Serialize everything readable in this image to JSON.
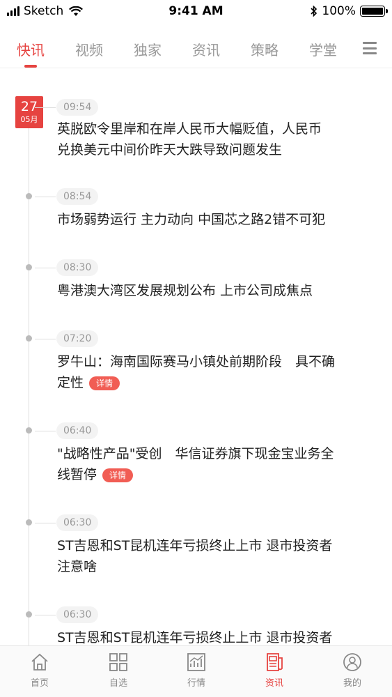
{
  "status_bar": {
    "carrier": "Sketch",
    "time": "9:41 AM",
    "battery": "100%",
    "battery_level": 1.0
  },
  "tabs": [
    {
      "label": "快讯",
      "active": true
    },
    {
      "label": "视频",
      "active": false
    },
    {
      "label": "独家",
      "active": false
    },
    {
      "label": "资讯",
      "active": false
    },
    {
      "label": "策略",
      "active": false
    },
    {
      "label": "学堂",
      "active": false
    }
  ],
  "date_badge": {
    "day": "27",
    "month": "05月"
  },
  "news": [
    {
      "time": "09:54",
      "line1": "英脱欧令里岸和在岸人民币大幅贬值，人民币",
      "line2": "兑换美元中间价昨天大跌导致问题发生",
      "detail": ""
    },
    {
      "time": "08:54",
      "line1": "市场弱势运行 主力动向 中国芯之路2错不可犯",
      "line2": "",
      "detail": ""
    },
    {
      "time": "08:30",
      "line1": "粤港澳大湾区发展规划公布 上市公司成焦点",
      "line2": "",
      "detail": ""
    },
    {
      "time": "07:20",
      "line1": "罗牛山：海南国际赛马小镇处前期阶段　具不确",
      "line2": "定性",
      "detail": "详情"
    },
    {
      "time": "06:40",
      "line1": "\"战略性产品\"受创　华信证券旗下现金宝业务全",
      "line2": "线暂停",
      "detail": "详情"
    },
    {
      "time": "06:30",
      "line1": "ST吉恩和ST昆机连年亏损终止上市 退市投资者",
      "line2": "注意啥",
      "detail": ""
    },
    {
      "time": "06:30",
      "line1": "ST吉恩和ST昆机连年亏损终止上市 退市投资者",
      "line2": "",
      "detail": ""
    }
  ],
  "bottom_nav": [
    {
      "label": "首页",
      "icon": "home-icon",
      "active": false
    },
    {
      "label": "自选",
      "icon": "grid-icon",
      "active": false
    },
    {
      "label": "行情",
      "icon": "chart-icon",
      "active": false
    },
    {
      "label": "资讯",
      "icon": "news-icon",
      "active": true
    },
    {
      "label": "我的",
      "icon": "user-icon",
      "active": false
    }
  ],
  "colors": {
    "accent": "#e64340",
    "muted": "#999999"
  }
}
